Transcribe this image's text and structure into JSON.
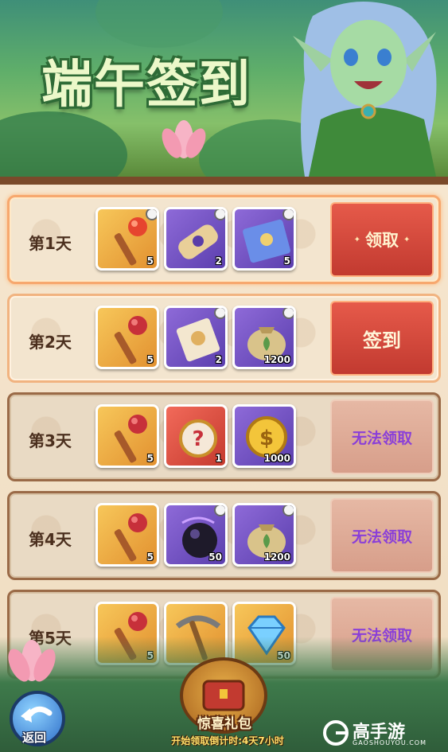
{
  "banner": {
    "title": "端午签到"
  },
  "days": [
    {
      "label": "第1天",
      "state": "claimable",
      "action": "领取",
      "items": [
        {
          "icon": "red-gourd-staff-icon",
          "frame": "gold",
          "qty": "5"
        },
        {
          "icon": "rolled-scroll-icon",
          "frame": "purple",
          "qty": "2"
        },
        {
          "icon": "blue-map-scroll-icon",
          "frame": "purple",
          "qty": "5"
        }
      ]
    },
    {
      "label": "第2天",
      "state": "checkin",
      "action": "签到",
      "items": [
        {
          "icon": "red-gourd-staff-icon",
          "frame": "gold",
          "qty": "5"
        },
        {
          "icon": "parchment-scroll-icon",
          "frame": "purple",
          "qty": "2"
        },
        {
          "icon": "coin-bag-icon",
          "frame": "purple",
          "qty": "1200"
        }
      ]
    },
    {
      "label": "第3天",
      "state": "locked",
      "action": "无法领取",
      "items": [
        {
          "icon": "red-gourd-staff-icon",
          "frame": "gold",
          "qty": "5"
        },
        {
          "icon": "mystery-box-icon",
          "frame": "red",
          "qty": "1"
        },
        {
          "icon": "gold-coin-icon",
          "frame": "purple",
          "qty": "1000"
        }
      ]
    },
    {
      "label": "第4天",
      "state": "locked",
      "action": "无法领取",
      "items": [
        {
          "icon": "red-gourd-staff-icon",
          "frame": "gold",
          "qty": "5"
        },
        {
          "icon": "dark-orb-icon",
          "frame": "purple",
          "qty": "50"
        },
        {
          "icon": "coin-bag-icon",
          "frame": "purple",
          "qty": "1200"
        }
      ]
    },
    {
      "label": "第5天",
      "state": "locked",
      "action": "无法领取",
      "items": [
        {
          "icon": "red-gourd-staff-icon",
          "frame": "gold",
          "qty": "5"
        },
        {
          "icon": "pickaxe-icon",
          "frame": "gold",
          "qty": ""
        },
        {
          "icon": "diamond-icon",
          "frame": "gold",
          "qty": "50"
        }
      ]
    }
  ],
  "bottom": {
    "back_label": "返回",
    "gift_label": "惊喜礼包",
    "countdown": "开始领取倒计时:4天7小时"
  },
  "watermark": {
    "brand": "高手游",
    "domain": "GAOSHOUYOU.COM"
  },
  "colors": {
    "claim": "#c23a30",
    "locked_text": "#8a3fd8",
    "gold_frame": "#e29130",
    "purple_frame": "#5b3fae"
  }
}
